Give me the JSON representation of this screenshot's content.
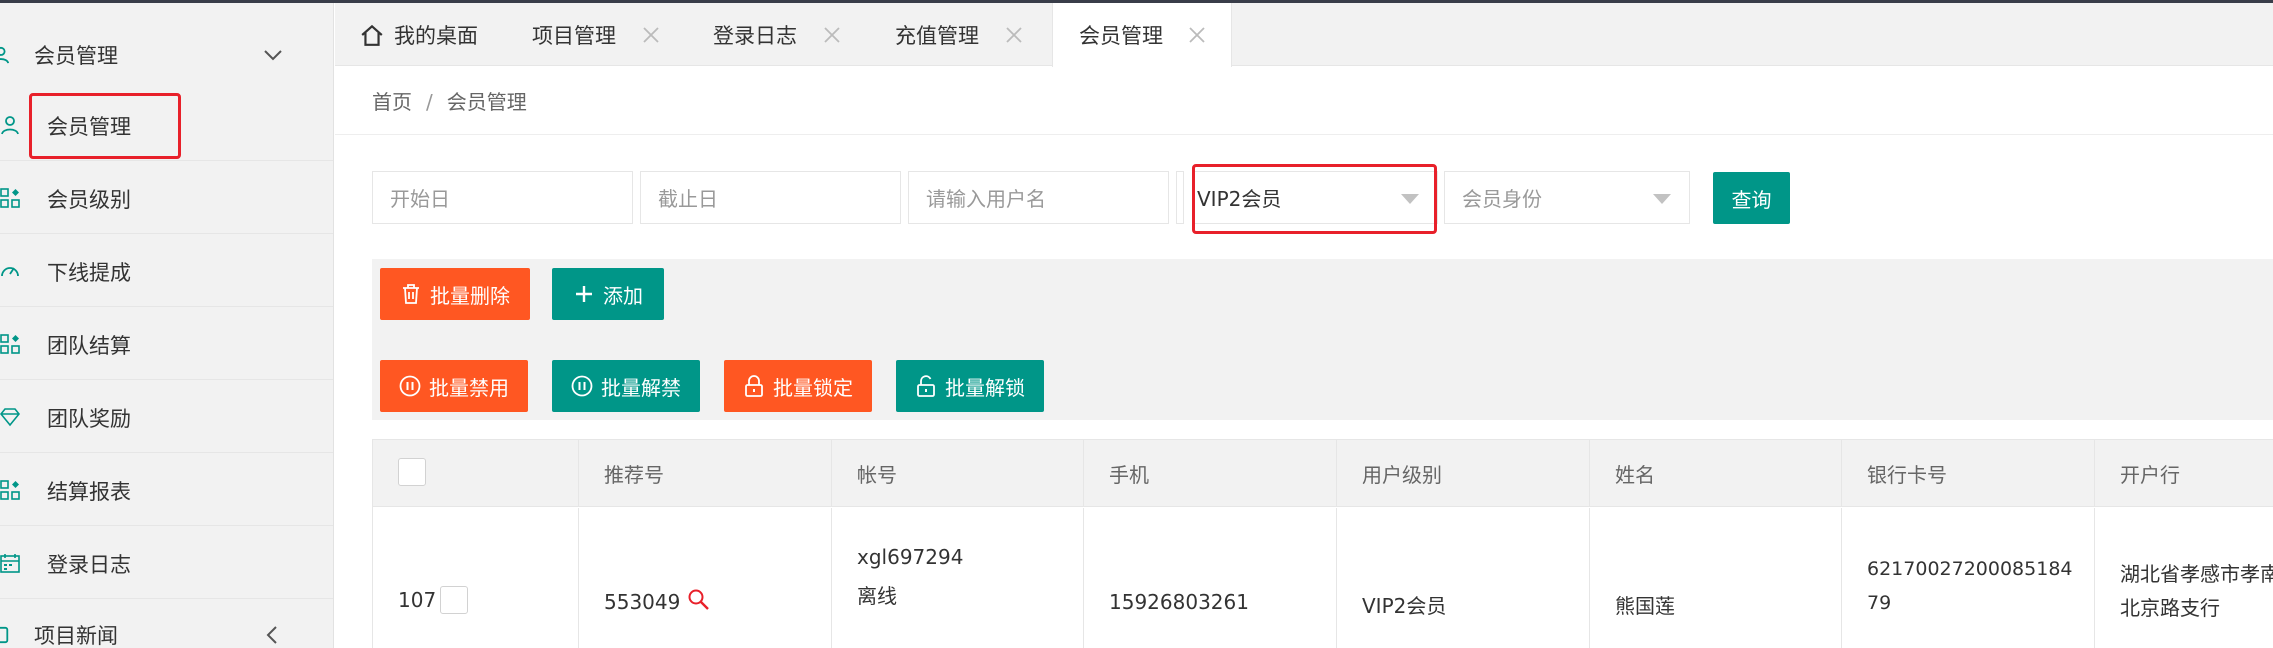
{
  "sidebar": {
    "group_top": {
      "label": "会员管理",
      "icon": "user-icon",
      "arrow": "chevron-down-icon"
    },
    "items": [
      {
        "label": "会员管理",
        "icon": "user-icon"
      },
      {
        "label": "会员级别",
        "icon": "grid-icon"
      },
      {
        "label": "下线提成",
        "icon": "gauge-icon"
      },
      {
        "label": "团队结算",
        "icon": "grid-icon"
      },
      {
        "label": "团队奖励",
        "icon": "diamond-icon"
      },
      {
        "label": "结算报表",
        "icon": "grid-icon"
      },
      {
        "label": "登录日志",
        "icon": "calendar-icon"
      }
    ],
    "group_bottom": {
      "label": "项目新闻",
      "icon": "news-icon",
      "arrow": "chevron-left-icon"
    }
  },
  "tabs": [
    {
      "label": "我的桌面",
      "icon": "home-icon"
    },
    {
      "label": "项目管理",
      "closable": true
    },
    {
      "label": "登录日志",
      "closable": true
    },
    {
      "label": "充值管理",
      "closable": true
    },
    {
      "label": "会员管理",
      "closable": true,
      "active": true
    }
  ],
  "breadcrumb": {
    "home": "首页",
    "separator": "/",
    "current": "会员管理"
  },
  "filters": {
    "start_date_placeholder": "开始日",
    "end_date_placeholder": "截止日",
    "username_placeholder": "请输入用户名",
    "level_select_value": "VIP2会员",
    "identity_select_placeholder": "会员身份",
    "search_button": "查询"
  },
  "toolbar": {
    "batch_delete": "批量删除",
    "add": "添加",
    "batch_disable": "批量禁用",
    "batch_enable": "批量解禁",
    "batch_lock": "批量锁定",
    "batch_unlock": "批量解锁"
  },
  "table": {
    "headers": [
      "推荐号",
      "帐号",
      "手机",
      "用户级别",
      "姓名",
      "银行卡号",
      "开户行"
    ],
    "rows": [
      {
        "id": "107",
        "referral": "553049",
        "account": "xgl697294",
        "status": "离线",
        "phone": "15926803261",
        "level": "VIP2会员",
        "name": "熊国莲",
        "card_line1": "62170027200085184",
        "card_line2": "79",
        "bank_line1": "湖北省孝感市孝南",
        "bank_line2": "北京路支行"
      }
    ]
  },
  "colors": {
    "green": "#009688",
    "orange": "#ff5722",
    "highlight": "#e8202a"
  }
}
